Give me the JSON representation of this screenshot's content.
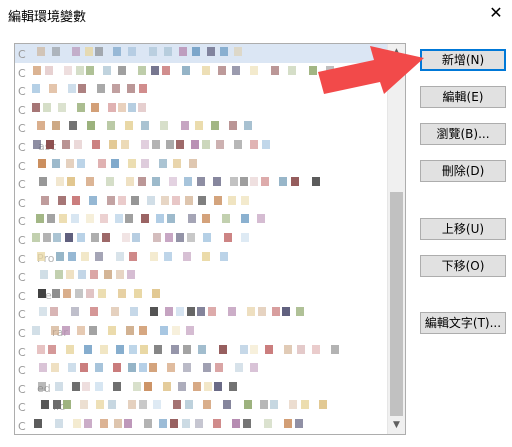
{
  "window": {
    "title": "編輯環境變數",
    "close_glyph": "✕"
  },
  "buttons": {
    "new": "新增(N)",
    "edit": "編輯(E)",
    "browse": "瀏覽(B)...",
    "delete": "刪除(D)",
    "move_up": "上移(U)",
    "move_down": "下移(O)",
    "edit_text": "編輯文字(T)..."
  },
  "list": {
    "row_count": 21,
    "row_prefix": "C",
    "ghost_labels": [
      "asc",
      "Pro",
      "e",
      "rar",
      "ed",
      "lic"
    ]
  },
  "annotation": {
    "arrow_color": "#f24a4a"
  }
}
